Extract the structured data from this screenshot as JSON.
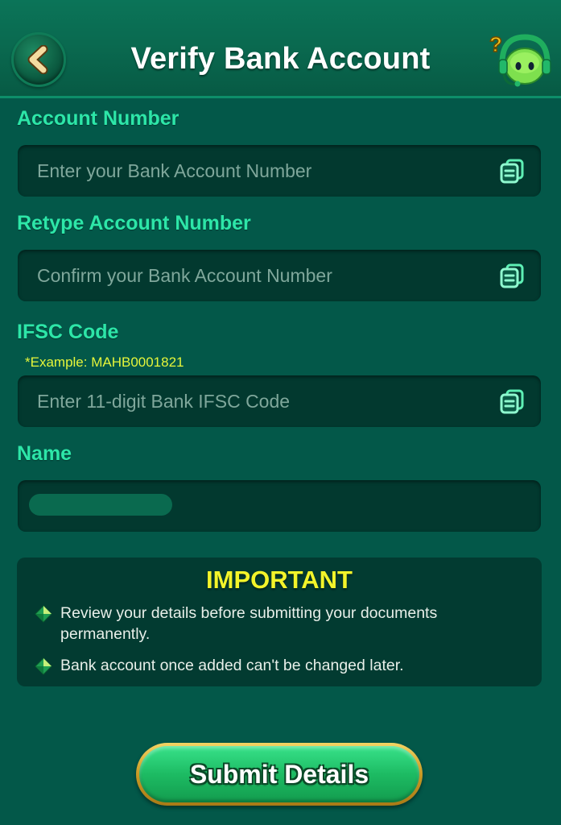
{
  "header": {
    "title": "Verify Bank Account",
    "back_icon": "chevron-left-icon",
    "support_icon": "headset-support-icon"
  },
  "fields": {
    "account_number": {
      "label": "Account Number",
      "placeholder": "Enter your Bank Account Number",
      "value": "",
      "action_icon": "paste-icon"
    },
    "retype_account_number": {
      "label": "Retype Account Number",
      "placeholder": "Confirm your Bank Account Number",
      "value": "",
      "action_icon": "paste-icon"
    },
    "ifsc": {
      "label": "IFSC Code",
      "hint": "*Example: MAHB0001821",
      "placeholder": "Enter 11-digit Bank IFSC Code",
      "value": "",
      "action_icon": "paste-icon"
    },
    "name": {
      "label": "Name",
      "value_redacted": true
    }
  },
  "important": {
    "title": "IMPORTANT",
    "bullets": [
      "Review your details before submitting your documents permanently.",
      "Bank account once added can't be changed later."
    ]
  },
  "submit": {
    "label": "Submit Details"
  },
  "colors": {
    "background": "#035849",
    "label": "#2de6a8",
    "hint": "#e6f53a",
    "important_title": "#f3f42a",
    "button_green": "#1dbb63",
    "button_gold": "#c99a24"
  }
}
